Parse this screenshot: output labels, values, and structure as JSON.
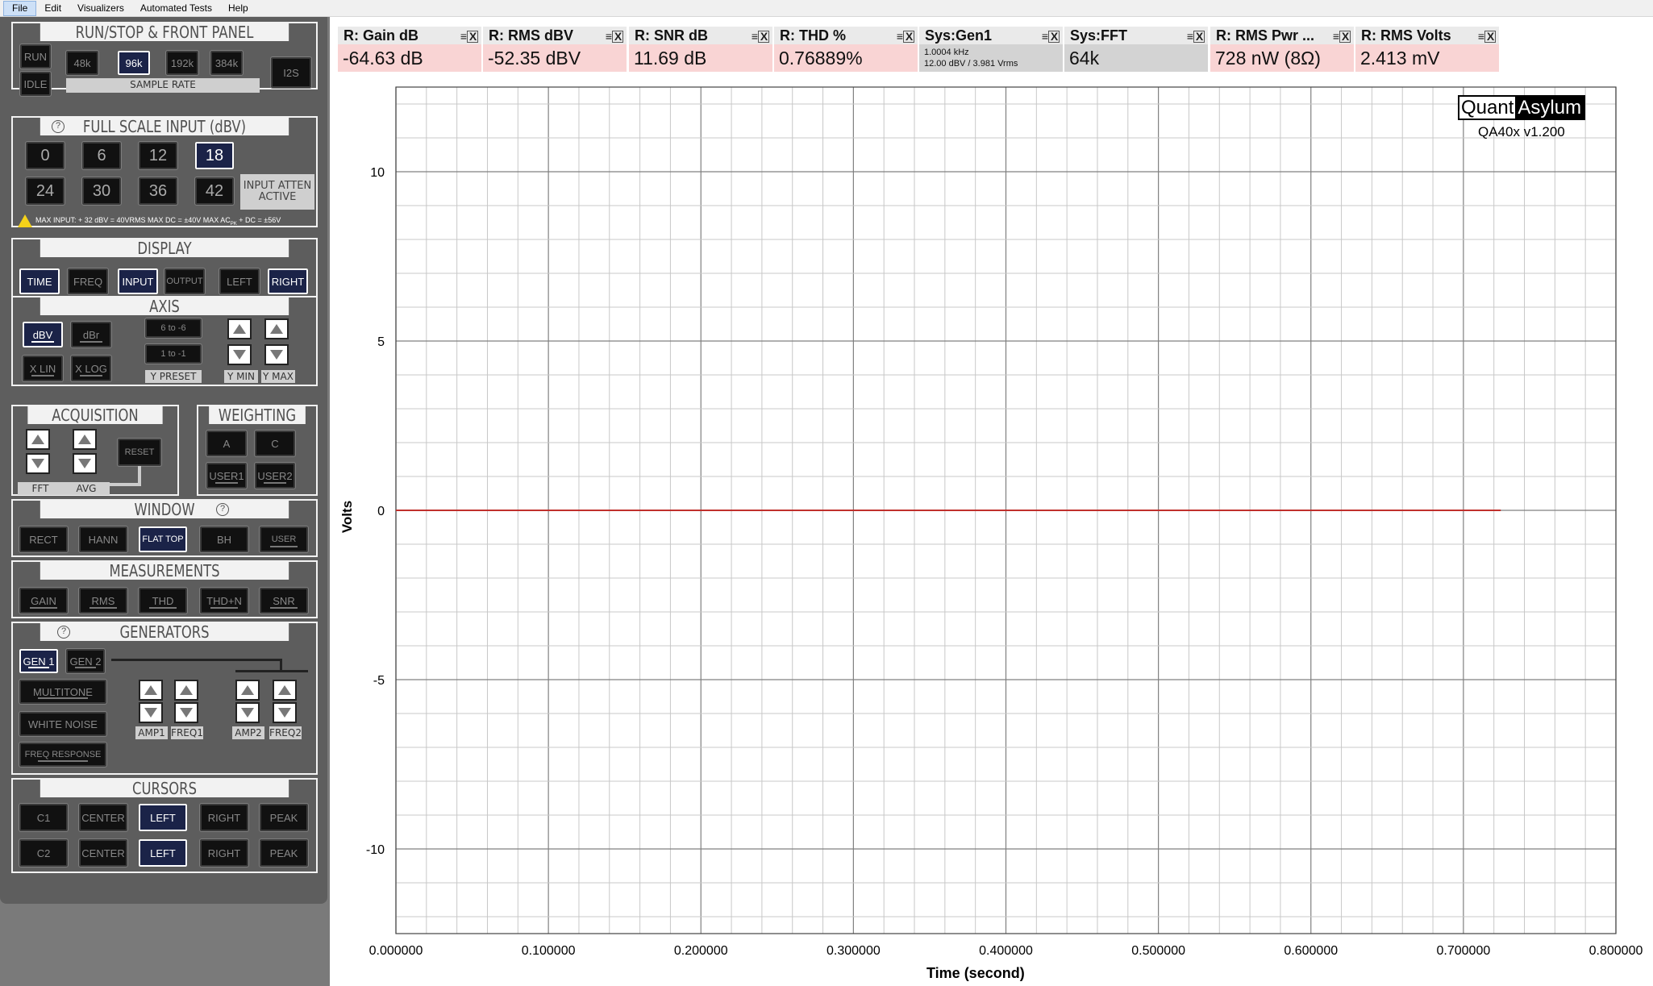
{
  "menu": [
    "File",
    "Edit",
    "Visualizers",
    "Automated Tests",
    "Help"
  ],
  "panels": {
    "run": {
      "title": "RUN/STOP & FRONT PANEL",
      "run": "RUN",
      "idle": "IDLE",
      "rates": [
        "48k",
        "96k",
        "192k",
        "384k"
      ],
      "rate_label": "SAMPLE RATE",
      "i2s": "I2S"
    },
    "fsi": {
      "title": "FULL SCALE INPUT (dBV)",
      "help": "?",
      "row1": [
        "0",
        "6",
        "12",
        "18"
      ],
      "row2": [
        "24",
        "30",
        "36",
        "42"
      ],
      "atten": "INPUT ATTEN ACTIVE",
      "warn": "MAX INPUT: + 32 dBV = 40VRMS     MAX DC = ±40V     MAX AC",
      "warn_sub": "PK",
      "warn_tail": " + DC = ±56V"
    },
    "display": {
      "title": "DISPLAY",
      "buttons": [
        "TIME",
        "FREQ",
        "INPUT",
        "OUTPUT",
        "LEFT",
        "RIGHT"
      ]
    },
    "axis": {
      "title": "AXIS",
      "dbv": "dBV",
      "dbr": "dBr",
      "xlin": "X LIN",
      "xlog": "X LOG",
      "preset1": "6 to -6",
      "preset2": "1 to -1",
      "ypreset": "Y PRESET",
      "ymin": "Y MIN",
      "ymax": "Y MAX"
    },
    "acq": {
      "title": "ACQUISITION",
      "reset": "RESET",
      "fft": "FFT",
      "avg": "AVG"
    },
    "weight": {
      "title": "WEIGHTING",
      "a": "A",
      "c": "C",
      "u1": "USER1",
      "u2": "USER2"
    },
    "window": {
      "title": "WINDOW",
      "help": "?",
      "buttons": [
        "RECT",
        "HANN",
        "FLAT TOP",
        "BH",
        "USER"
      ]
    },
    "meas": {
      "title": "MEASUREMENTS",
      "buttons": [
        "GAIN",
        "RMS",
        "THD",
        "THD+N",
        "SNR"
      ]
    },
    "gen": {
      "title": "GENERATORS",
      "help": "?",
      "gen1": "GEN 1",
      "gen2": "GEN 2",
      "multitone": "MULTITONE",
      "white": "WHITE NOISE",
      "freqresp": "FREQ RESPONSE",
      "amp1": "AMP1",
      "freq1": "FREQ1",
      "amp2": "AMP2",
      "freq2": "FREQ2"
    },
    "cursors": {
      "title": "CURSORS",
      "row1": [
        "C1",
        "CENTER",
        "LEFT",
        "RIGHT",
        "PEAK"
      ],
      "row2": [
        "C2",
        "CENTER",
        "LEFT",
        "RIGHT",
        "PEAK"
      ]
    }
  },
  "tiles": [
    {
      "title": "R: Gain dB",
      "value": "-64.63 dB"
    },
    {
      "title": "R: RMS dBV",
      "value": "-52.35 dBV"
    },
    {
      "title": "R: SNR dB",
      "value": "11.69 dB"
    },
    {
      "title": "R: THD %",
      "value": "0.76889%"
    },
    {
      "title": "Sys:Gen1",
      "value1": "1.0004 kHz",
      "value2": "12.00 dBV  / 3.981 Vrms"
    },
    {
      "title": "Sys:FFT",
      "value": "64k"
    },
    {
      "title": "R: RMS Pwr ...",
      "value": "728 nW (8Ω)"
    },
    {
      "title": "R: RMS Volts",
      "value": "2.413 mV"
    }
  ],
  "brand": {
    "quant": "Quant",
    "asylum": "Asylum",
    "version": "QA40x v1.200"
  },
  "chart_data": {
    "type": "line",
    "xlabel": "Time (second)",
    "ylabel": "Volts",
    "xlim": [
      0,
      0.8
    ],
    "ylim": [
      -12.5,
      12.5
    ],
    "xticks": [
      "0.000000",
      "0.100000",
      "0.200000",
      "0.300000",
      "0.400000",
      "0.500000",
      "0.600000",
      "0.700000",
      "0.800000"
    ],
    "yticks": [
      "10",
      "5",
      "0",
      "-5",
      "-10"
    ],
    "series": [
      {
        "color": "#c0302c",
        "x": [
          0,
          0.7245
        ],
        "y": [
          0,
          0
        ]
      }
    ],
    "grid": true
  },
  "colors": {
    "trace": "#c0302c",
    "tile_red": "#f9d4d4",
    "tile_gray": "#d3d3d3",
    "button_on": "#1b2348"
  }
}
